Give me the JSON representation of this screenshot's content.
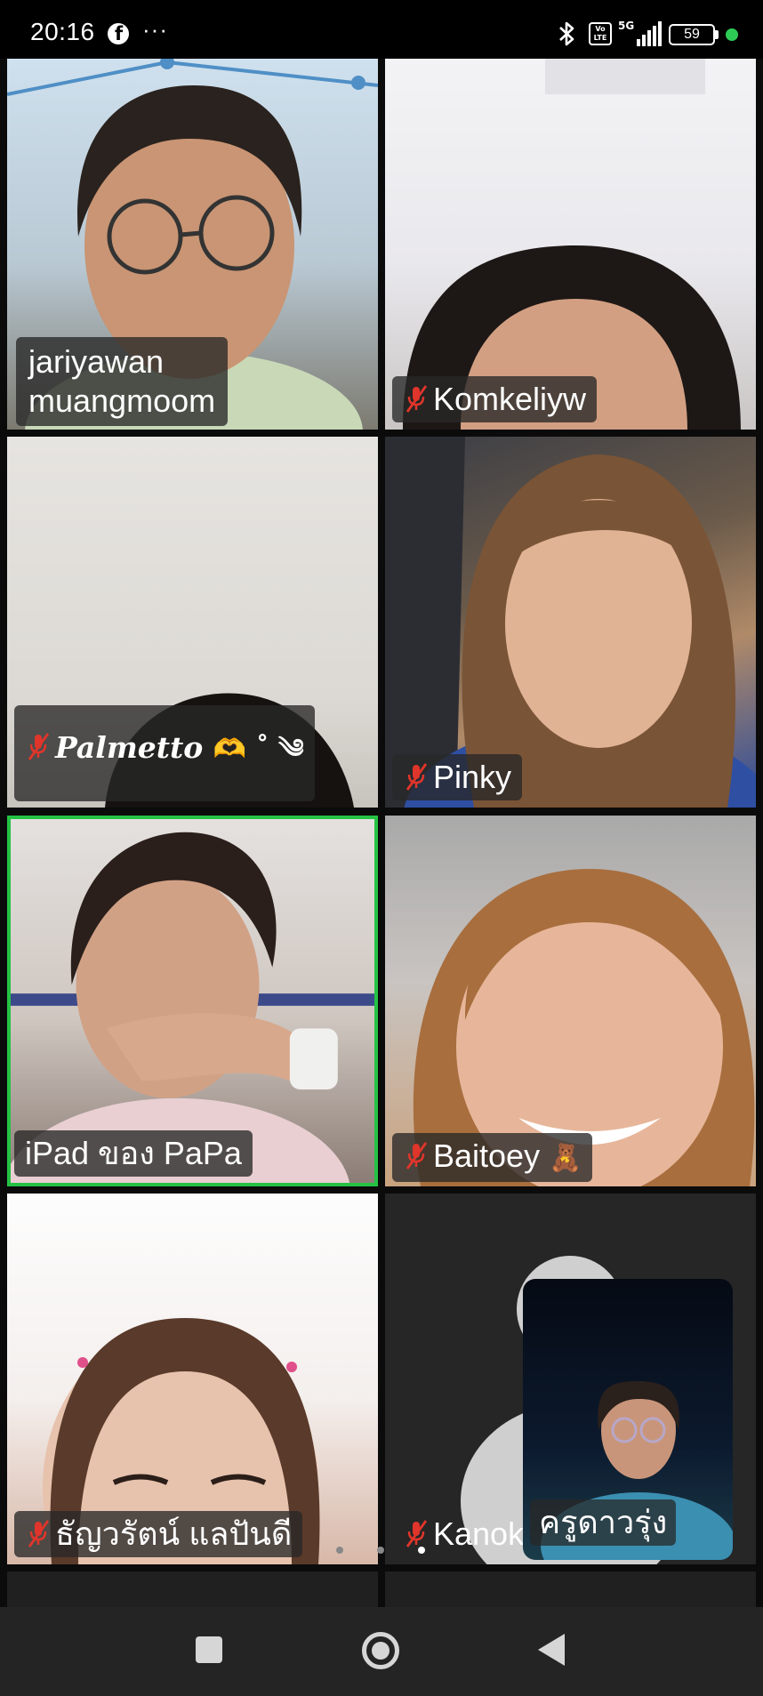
{
  "status_bar": {
    "time": "20:16",
    "more": "···",
    "network_type": "5G",
    "volte": "Vo LTE",
    "battery_level": "59",
    "icons": [
      "facebook-icon",
      "bluetooth-icon",
      "volte-icon",
      "signal-icon",
      "battery-icon"
    ]
  },
  "participants": [
    {
      "name_line1": "jariyawan",
      "name_line2": "muangmoom",
      "muted": false
    },
    {
      "name": "Komkeliyw",
      "muted": true
    },
    {
      "name": "Palmetto",
      "emoji": "🫶 ˚ ༄",
      "muted": true
    },
    {
      "name": "Pinky",
      "muted": true
    },
    {
      "name": "iPad ของ PaPa",
      "muted": false,
      "active_speaker": true
    },
    {
      "name": "Baitoey",
      "emoji": "🧸",
      "muted": true
    },
    {
      "name": "ธัญวรัตน์ แลปันดี",
      "muted": true
    },
    {
      "name": "Kanok",
      "muted": true,
      "camera_off": true
    }
  ],
  "self_view": {
    "name": "ครูดาวรุ่ง"
  },
  "pagination": {
    "pages": 3,
    "current": 3
  },
  "colors": {
    "active_speaker_border": "#25c244",
    "muted_icon": "#e0352b",
    "name_tag_bg": "#282828"
  }
}
